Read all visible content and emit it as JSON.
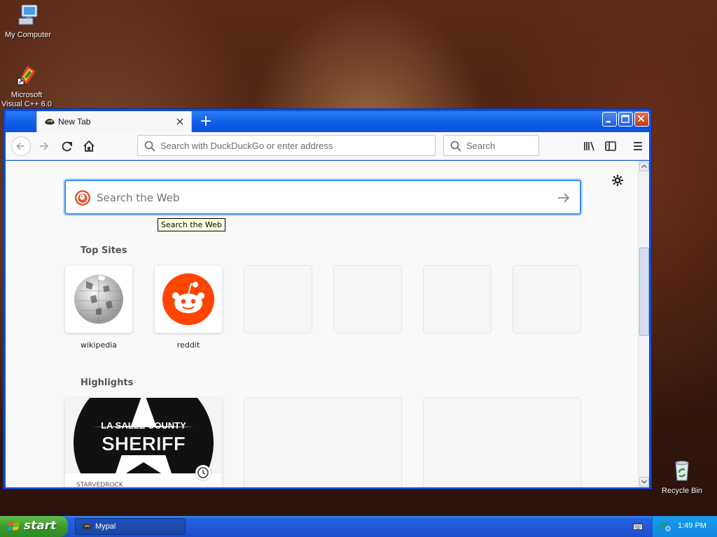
{
  "desktop": {
    "icons": [
      {
        "label": "My Computer"
      },
      {
        "label": "Microsoft Visual C++ 6.0"
      },
      {
        "label": "Recycle Bin"
      }
    ]
  },
  "browser": {
    "tab": {
      "title": "New Tab",
      "close": "×"
    },
    "new_tab": "+",
    "urlbar": {
      "placeholder": "Search with DuckDuckGo or enter address"
    },
    "searchbar": {
      "placeholder": "Search"
    },
    "page": {
      "search_placeholder": "Search the Web",
      "tooltip": "Search the Web",
      "top_sites_title": "Top Sites",
      "top_sites": [
        {
          "label": "wikipedia"
        },
        {
          "label": "reddit"
        },
        {
          "label": ""
        },
        {
          "label": ""
        },
        {
          "label": ""
        },
        {
          "label": ""
        }
      ],
      "highlights_title": "Highlights",
      "highlights": [
        {
          "host": "STARVEDROCK",
          "image_text_top": "LA SALLE COUNTY",
          "image_text_main": "SHERIFF"
        },
        {
          "host": ""
        },
        {
          "host": ""
        }
      ]
    }
  },
  "taskbar": {
    "start_label": "start",
    "task_label": "Mypal",
    "clock": "1:49 PM"
  },
  "colors": {
    "titlebar": "#0a4fd8",
    "focus_ring": "#3b8ef0",
    "reddit": "#ff4500",
    "start_green": "#3c9a2b"
  }
}
